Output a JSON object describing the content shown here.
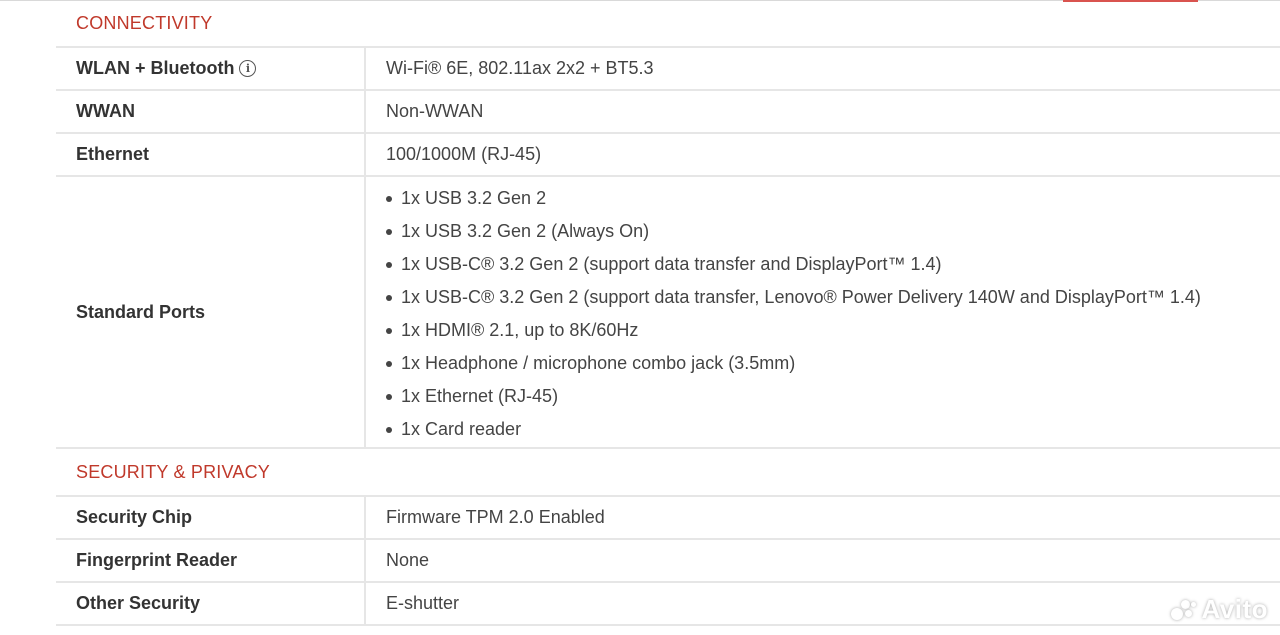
{
  "colors": {
    "accent": "#c0392b",
    "border": "#e6e6e6",
    "text": "#333333"
  },
  "sections": {
    "connectivity": {
      "title": "CONNECTIVITY",
      "rows": [
        {
          "label": "WLAN + Bluetooth",
          "value": "Wi-Fi® 6E, 802.11ax 2x2 + BT5.3",
          "info_icon": "info-icon"
        },
        {
          "label": "WWAN",
          "value": "Non-WWAN"
        },
        {
          "label": "Ethernet",
          "value": "100/1000M (RJ-45)"
        }
      ],
      "ports": {
        "label": "Standard Ports",
        "items": [
          "1x USB 3.2 Gen 2",
          "1x USB 3.2 Gen 2 (Always On)",
          "1x USB-C® 3.2 Gen 2 (support data transfer and DisplayPort™ 1.4)",
          "1x USB-C® 3.2 Gen 2 (support data transfer, Lenovo® Power Delivery 140W and DisplayPort™ 1.4)",
          "1x HDMI® 2.1, up to 8K/60Hz",
          "1x Headphone / microphone combo jack (3.5mm)",
          "1x Ethernet (RJ-45)",
          "1x Card reader"
        ]
      }
    },
    "security": {
      "title": "SECURITY & PRIVACY",
      "rows": [
        {
          "label": "Security Chip",
          "value": "Firmware TPM 2.0 Enabled"
        },
        {
          "label": "Fingerprint Reader",
          "value": "None"
        },
        {
          "label": "Other Security",
          "value": "E-shutter"
        }
      ]
    }
  },
  "watermark": {
    "text": "Avito"
  }
}
